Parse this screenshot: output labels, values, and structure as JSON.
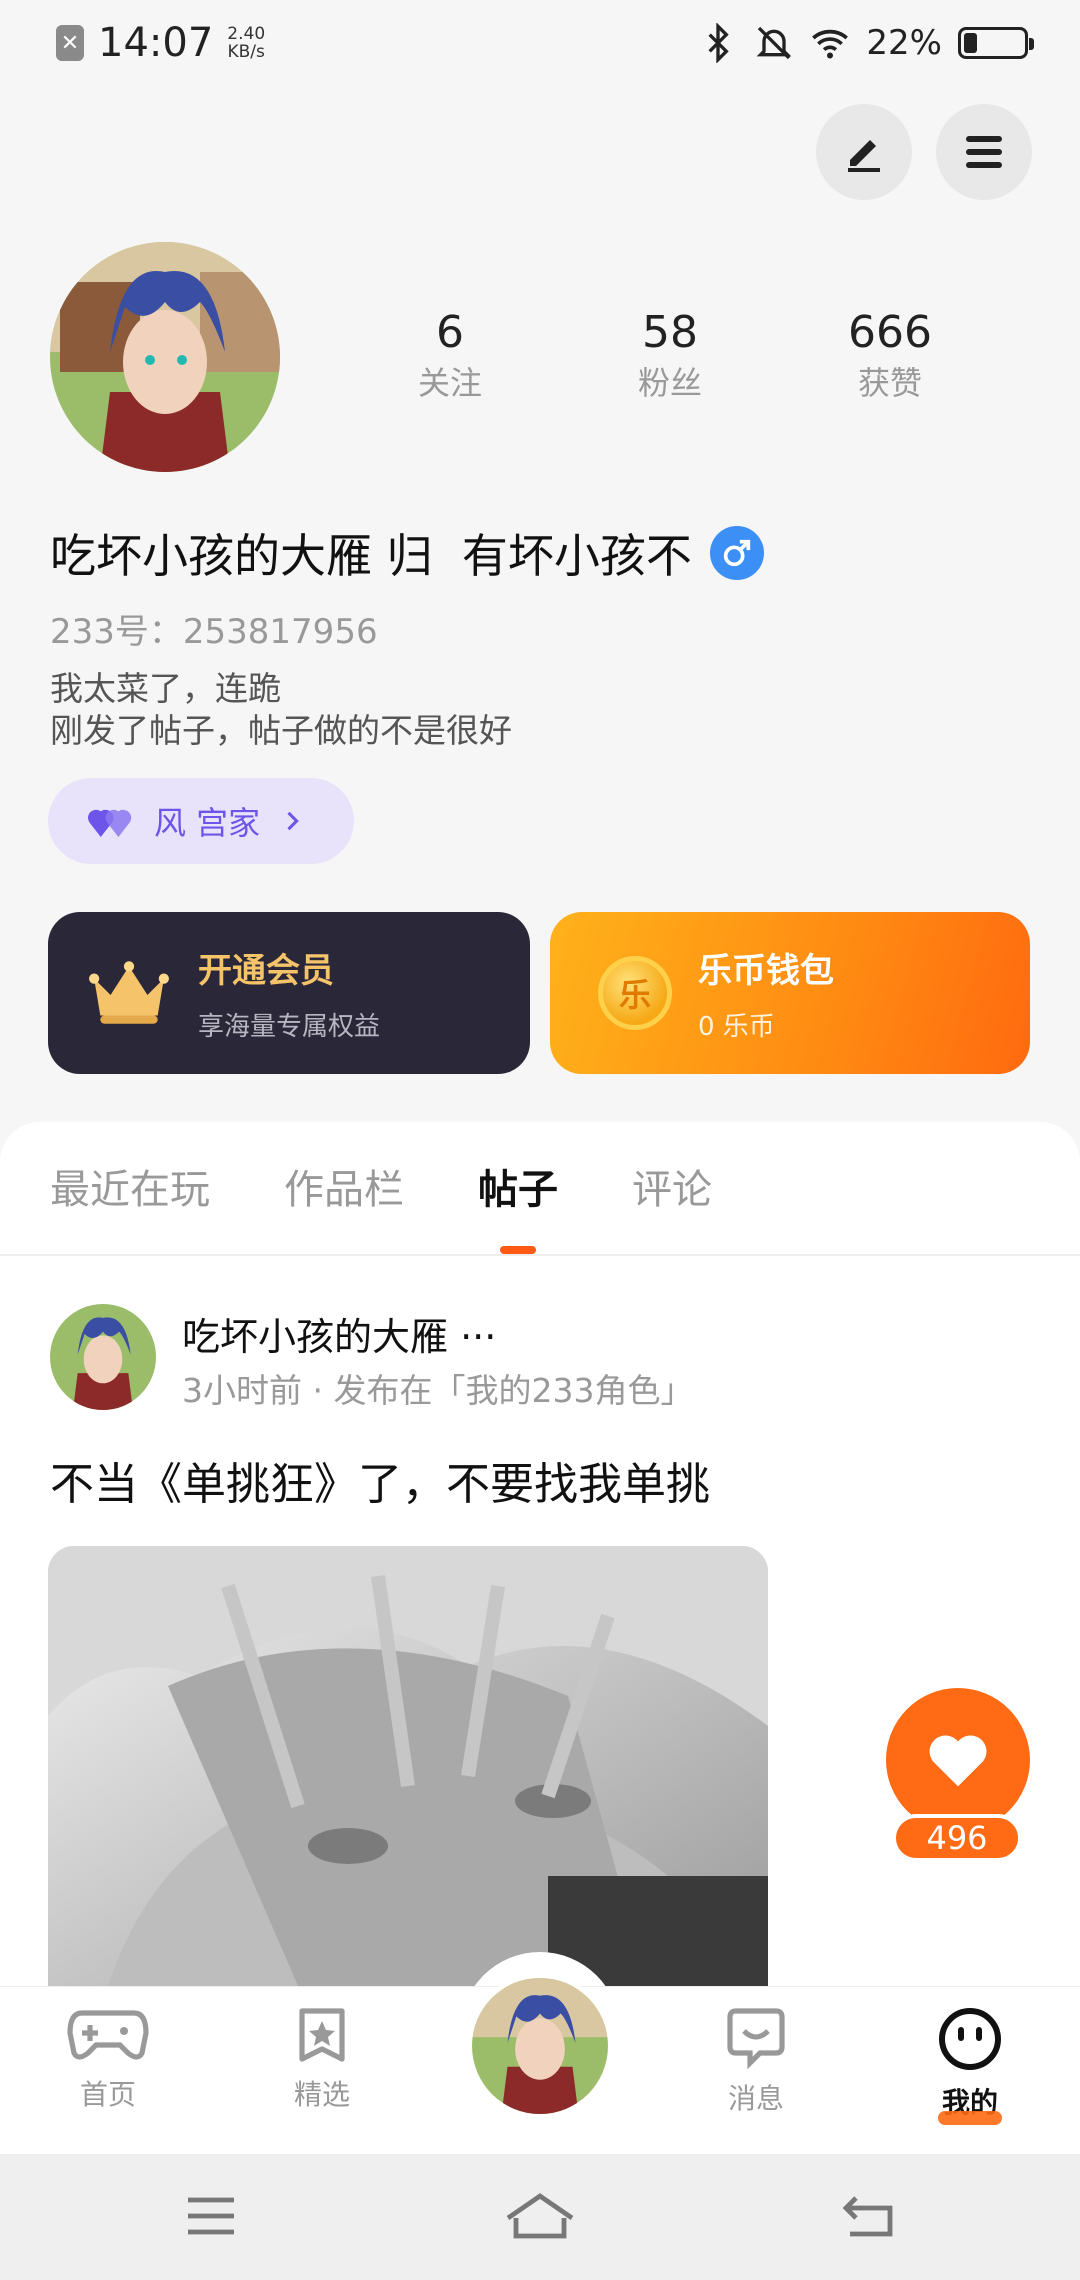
{
  "status": {
    "time": "14:07",
    "speed_value": "2.40",
    "speed_unit": "KB/s",
    "battery": "22%",
    "battery_level": 0.22
  },
  "profile": {
    "stats": [
      {
        "value": "6",
        "label": "关注"
      },
      {
        "value": "58",
        "label": "粉丝"
      },
      {
        "value": "666",
        "label": "获赞"
      }
    ],
    "nickname": "吃坏小孩的大雁 归  有坏小孩不",
    "uid": "233号：253817956",
    "bio_line1": "我太菜了，连跪",
    "bio_line2": "刚发了帖子，帖子做的不是很好",
    "family_label": "风 宫家"
  },
  "cards": {
    "vip_title": "开通会员",
    "vip_sub": "享海量专属权益",
    "wallet_title": "乐币钱包",
    "wallet_sub": "0 乐币",
    "coin_glyph": "乐"
  },
  "tabs": [
    {
      "label": "最近在玩"
    },
    {
      "label": "作品栏"
    },
    {
      "label": "帖子"
    },
    {
      "label": "评论"
    }
  ],
  "post": {
    "author": "吃坏小孩的大雁 ···",
    "meta": "3小时前 · 发布在「我的233角色」",
    "text": "不当《单挑狂》了，不要找我单挑",
    "likes": "496"
  },
  "nav": [
    {
      "label": "首页"
    },
    {
      "label": "精选"
    },
    {
      "label": "消息"
    },
    {
      "label": "我的"
    }
  ],
  "colors": {
    "accent": "#ff6a14",
    "vip_bg": "#2a2838",
    "family": "#6c55e8",
    "gender": "#3c8ff5"
  }
}
